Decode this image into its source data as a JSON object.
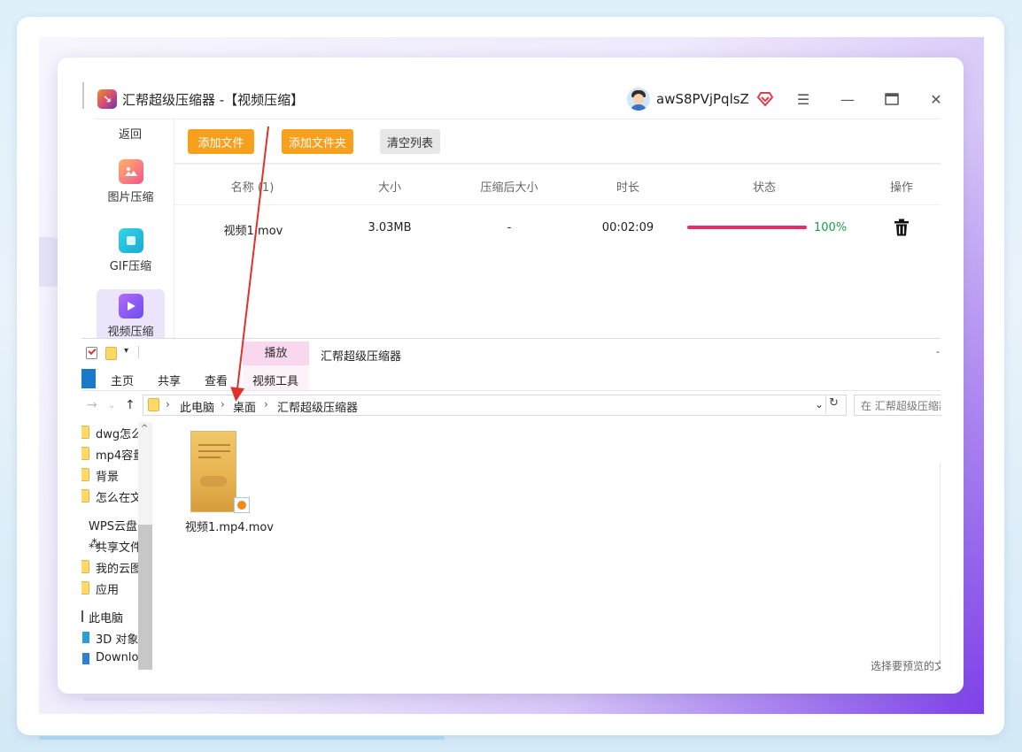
{
  "app": {
    "title": "汇帮超级压缩器  -【视频压缩】",
    "logo_icon": "app-logo-icon",
    "user_name": "awS8PVjPqlsZ",
    "vip_icon": "heart-diamond-icon",
    "controls": [
      "menu-icon",
      "minimize-icon",
      "maximize-icon",
      "close-icon"
    ]
  },
  "sidebar": {
    "back_label": "返回",
    "items": [
      {
        "label": "图片压缩",
        "icon": "image-compress-icon"
      },
      {
        "label": "GIF压缩",
        "icon": "gif-compress-icon"
      },
      {
        "label": "视频压缩",
        "icon": "video-compress-icon",
        "active": true
      }
    ]
  },
  "toolbar": {
    "add_file": "添加文件",
    "add_folder": "添加文件夹",
    "clear_list": "清空列表"
  },
  "table": {
    "headers": [
      "名称 (1)",
      "大小",
      "压缩后大小",
      "时长",
      "状态",
      "操作"
    ],
    "rows": [
      {
        "name": "视频1.mov",
        "size": "3.03MB",
        "compressed_size": "-",
        "duration": "00:02:09",
        "progress": 1.0,
        "progress_label": "100%",
        "action_icon": "trash-icon"
      }
    ]
  },
  "explorer": {
    "title": "汇帮超级压缩器",
    "context_tab": "播放",
    "ribbon_tabs": [
      "主页",
      "共享",
      "查看",
      "视频工具"
    ],
    "breadcrumb": [
      "此电脑",
      "桌面",
      "汇帮超级压缩器"
    ],
    "search_placeholder": "在 汇帮超级压缩器",
    "tree": [
      "dwg怎么",
      "mp4容量",
      "背景",
      "怎么在文",
      "WPS云盘",
      "共享文件",
      "我的云图",
      "应用",
      "此电脑",
      "3D 对象",
      "Downloa"
    ],
    "files": [
      {
        "name": "视频1.mp4.mov",
        "icon": "video-file-icon"
      }
    ],
    "preview_hint": "选择要预览的文"
  },
  "colors": {
    "accent_orange": "#f7a01e",
    "progress": "#e72a68",
    "success_text": "#1aa04a",
    "active_nav_bg": "#ece4fb",
    "arrow": "#e0312b"
  }
}
